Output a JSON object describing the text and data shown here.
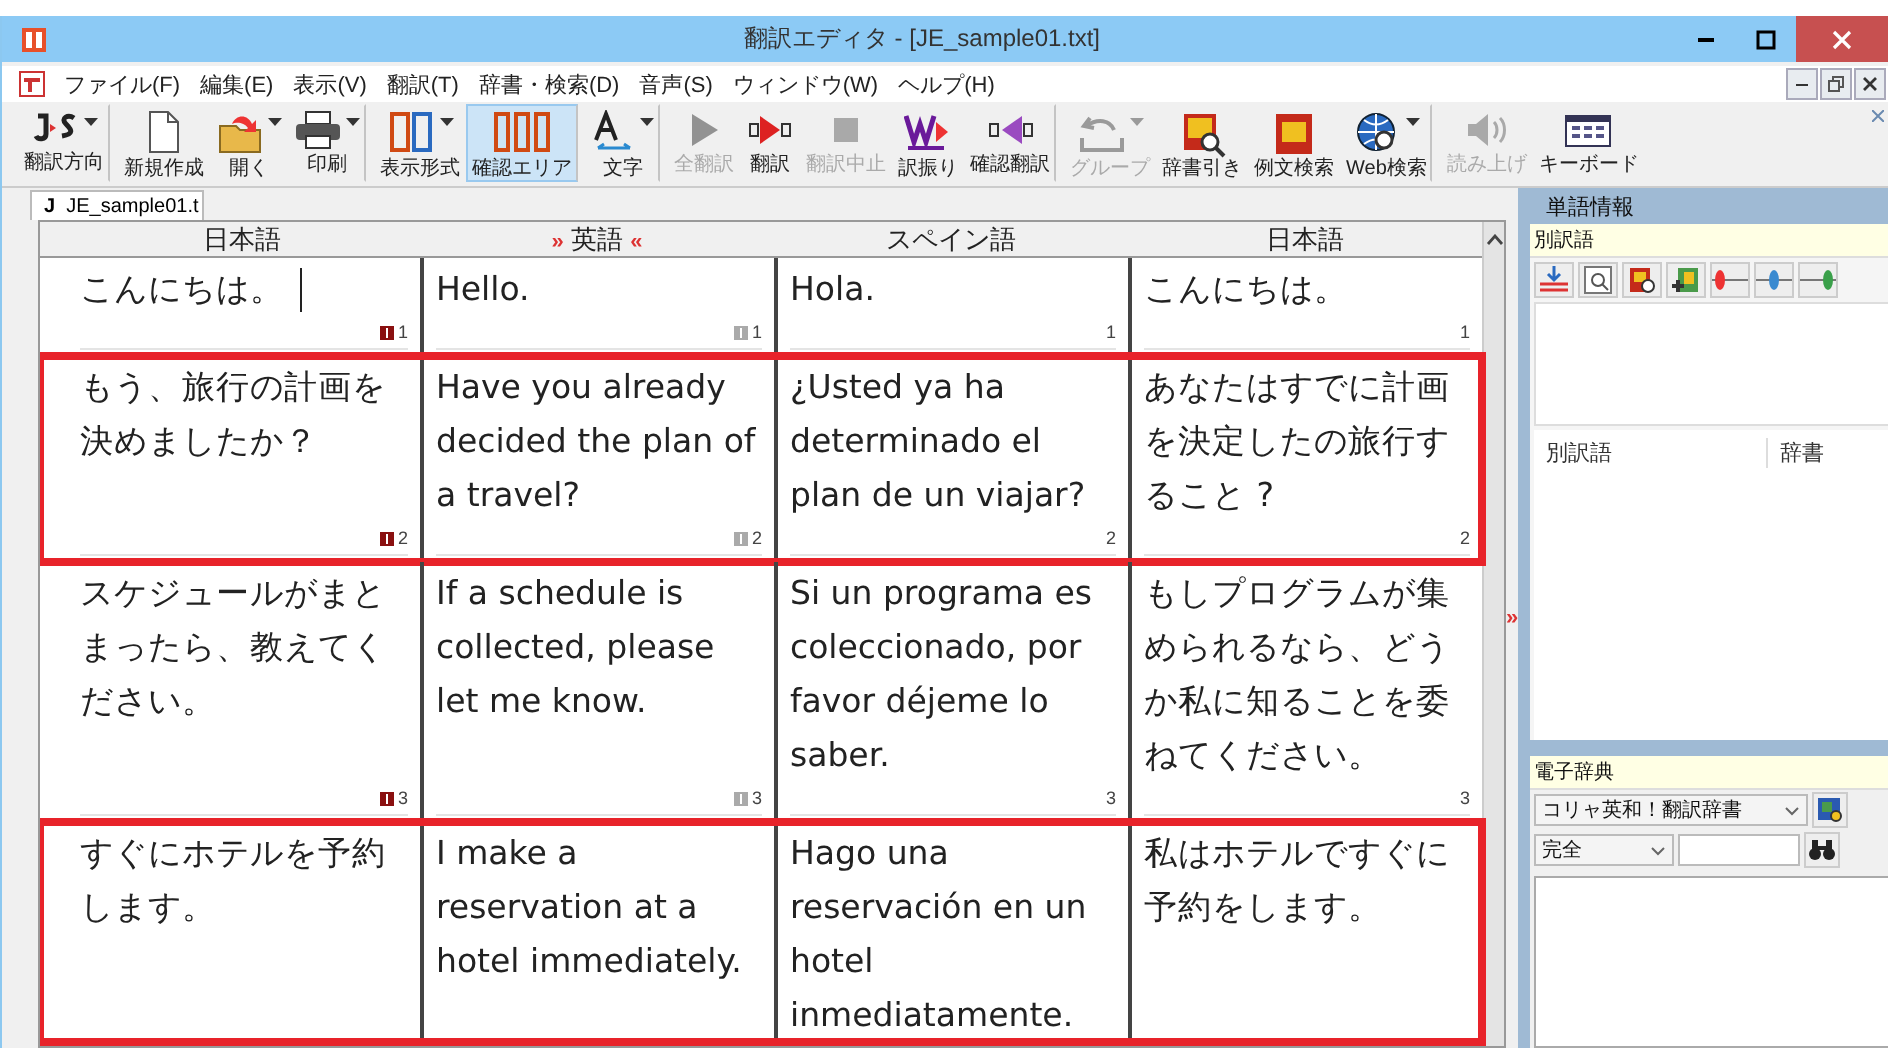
{
  "window": {
    "title": "翻訳エディタ - [JE_sample01.txt]"
  },
  "menu": [
    "ファイル(F)",
    "編集(E)",
    "表示(V)",
    "翻訳(T)",
    "辞書・検索(D)",
    "音声(S)",
    "ウィンドウ(W)",
    "ヘルプ(H)"
  ],
  "toolbar": [
    {
      "label": "翻訳方向",
      "kind": "js",
      "dropdown": true,
      "disabled": false,
      "selected": false,
      "group_end": true
    },
    {
      "label": "新規作成",
      "kind": "page",
      "dropdown": false,
      "disabled": false,
      "selected": false,
      "group_end": false
    },
    {
      "label": "開く",
      "kind": "folder",
      "dropdown": true,
      "disabled": false,
      "selected": false,
      "group_end": false
    },
    {
      "label": "印刷",
      "kind": "printer",
      "dropdown": true,
      "disabled": false,
      "selected": false,
      "group_end": true
    },
    {
      "label": "表示形式",
      "kind": "columns2",
      "dropdown": true,
      "disabled": false,
      "selected": false,
      "group_end": false
    },
    {
      "label": "確認エリア",
      "kind": "columns3",
      "dropdown": false,
      "disabled": false,
      "selected": true,
      "group_end": true
    },
    {
      "label": "文字",
      "kind": "font",
      "dropdown": true,
      "disabled": false,
      "selected": false,
      "group_end": true
    },
    {
      "label": "全翻訳",
      "kind": "play",
      "dropdown": false,
      "disabled": true,
      "selected": false,
      "group_end": false
    },
    {
      "label": "翻訳",
      "kind": "translate",
      "dropdown": false,
      "disabled": false,
      "selected": false,
      "group_end": false
    },
    {
      "label": "翻訳中止",
      "kind": "stop",
      "dropdown": false,
      "disabled": true,
      "selected": false,
      "group_end": false
    },
    {
      "label": "訳振り",
      "kind": "w",
      "dropdown": false,
      "disabled": false,
      "selected": false,
      "group_end": false
    },
    {
      "label": "確認翻訳",
      "kind": "back",
      "dropdown": false,
      "disabled": false,
      "selected": false,
      "group_end": true
    },
    {
      "label": "グループ",
      "kind": "undo",
      "dropdown": true,
      "disabled": true,
      "selected": false,
      "group_end": false
    },
    {
      "label": "辞書引き",
      "kind": "bookd",
      "dropdown": false,
      "disabled": false,
      "selected": false,
      "group_end": false
    },
    {
      "label": "例文検索",
      "kind": "bookex",
      "dropdown": false,
      "disabled": false,
      "selected": false,
      "group_end": false
    },
    {
      "label": "Web検索",
      "kind": "globe",
      "dropdown": true,
      "disabled": false,
      "selected": false,
      "group_end": true
    },
    {
      "label": "読み上げ",
      "kind": "speaker",
      "dropdown": false,
      "disabled": true,
      "selected": false,
      "group_end": false
    },
    {
      "label": "キーボード",
      "kind": "keyboard",
      "dropdown": false,
      "disabled": false,
      "selected": false,
      "group_end": false
    }
  ],
  "document_tab": {
    "prefix": "J",
    "label": "JE_sample01.t"
  },
  "table": {
    "columns": [
      {
        "label": "日本語"
      },
      {
        "label": "英語",
        "prefix": "»",
        "suffix": "«"
      },
      {
        "label": "スペイン語"
      },
      {
        "label": "日本語"
      }
    ],
    "rows": [
      {
        "highlighted": false,
        "cursor": true,
        "cells": [
          {
            "text": "こんにちは。",
            "number": "1"
          },
          {
            "text": "Hello.",
            "number": "1"
          },
          {
            "text": "Hola.",
            "number": "1"
          },
          {
            "text": "こんにちは。",
            "number": "1"
          }
        ]
      },
      {
        "highlighted": true,
        "cursor": false,
        "cells": [
          {
            "text": "もう、旅行の計画を決めましたか？",
            "number": "2"
          },
          {
            "text": "Have you already decided the plan of a travel?",
            "number": "2"
          },
          {
            "text": "¿Usted ya ha determinado el plan de un viajar?",
            "number": "2"
          },
          {
            "text": "あなたはすでに計画を決定したの旅行すること ?",
            "number": "2"
          }
        ]
      },
      {
        "highlighted": false,
        "cursor": false,
        "cells": [
          {
            "text": "スケジュールがまとまったら、教えてください。",
            "number": "3"
          },
          {
            "text": "If a schedule is collected, please let me know.",
            "number": "3"
          },
          {
            "text": "Si un programa es coleccionado, por favor déjeme lo saber.",
            "number": "3"
          },
          {
            "text": "もしプログラムが集められるなら、どうか私に知ることを委ねてください。",
            "number": "3"
          }
        ]
      },
      {
        "highlighted": true,
        "cursor": false,
        "cells": [
          {
            "text": "すぐにホテルを予約します。"
          },
          {
            "text": "I make a reservation at a hotel immediately."
          },
          {
            "text": "Hago una reservación en un hotel inmediatamente."
          },
          {
            "text": "私はホテルですぐに予約をします。"
          }
        ]
      }
    ]
  },
  "splitter": {
    "label": "»"
  },
  "word_info": {
    "title": "単語情報",
    "alt_label": "別訳語",
    "columns": [
      "別訳語",
      "辞書"
    ]
  },
  "dictionary": {
    "title": "電子辞典",
    "dictionary_select": "コリャ英和！翻訳辞書",
    "match_select": "完全"
  }
}
